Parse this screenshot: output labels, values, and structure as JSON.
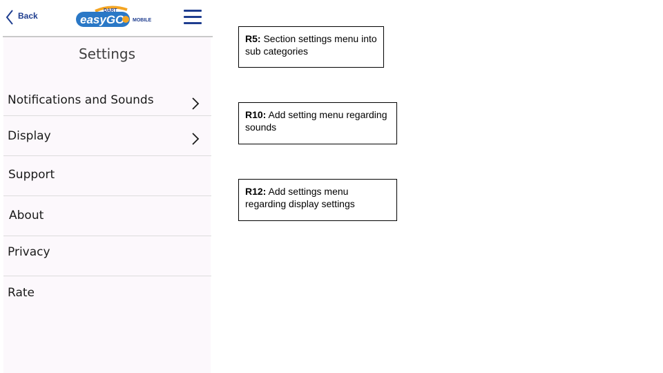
{
  "header": {
    "back_label": "Back",
    "logo": {
      "top_text": "DART",
      "brand_text": "easyGO",
      "suffix": "MOBILE"
    },
    "menu_icon": "hamburger-menu-icon"
  },
  "page": {
    "title": "Settings"
  },
  "settings_items": [
    {
      "label": "Notifications and Sounds",
      "has_chevron": true
    },
    {
      "label": "Display",
      "has_chevron": true
    },
    {
      "label": "Support",
      "has_chevron": false
    },
    {
      "label": "About",
      "has_chevron": false
    },
    {
      "label": "Privacy",
      "has_chevron": false
    },
    {
      "label": "Rate",
      "has_chevron": false
    }
  ],
  "annotations": [
    {
      "id": "R5:",
      "text": "Section settings menu into sub categories"
    },
    {
      "id": "R10:",
      "text": "Add setting menu regarding sounds"
    },
    {
      "id": "R12:",
      "text": "Add settings menu regarding display settings"
    }
  ],
  "colors": {
    "brand_blue": "#1e3d8f",
    "logo_blue": "#2a78c6",
    "logo_orange": "#f4a523",
    "content_bg": "#fcf8fc"
  }
}
